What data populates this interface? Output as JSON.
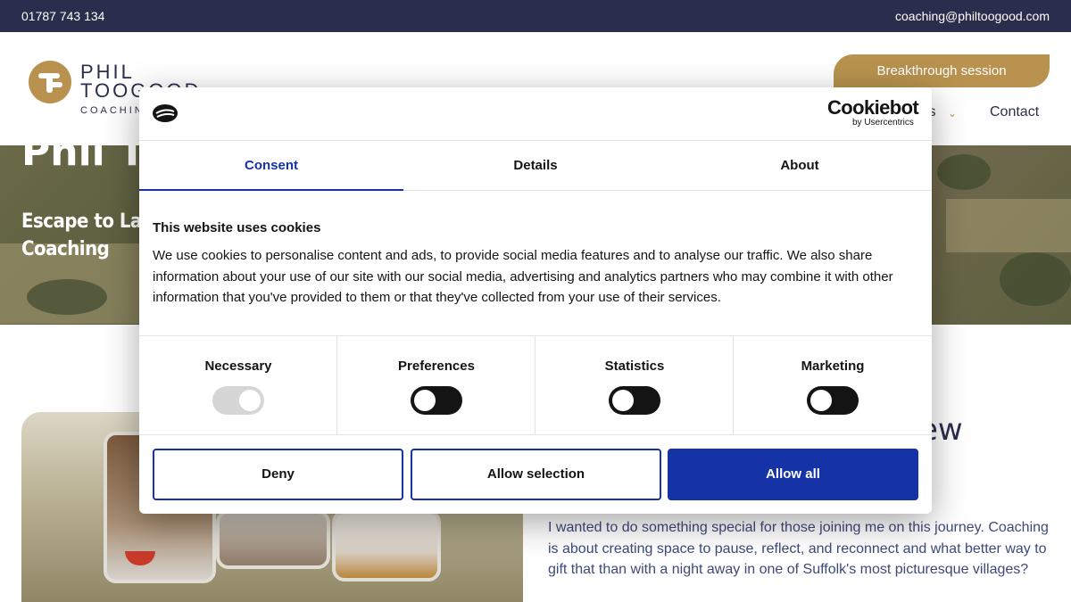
{
  "topbar": {
    "phone": "01787 743 134",
    "email": "coaching@philtoogood.com"
  },
  "header": {
    "logo_name_line1": "PHIL",
    "logo_name_line2": "TOOGOOD",
    "logo_sub": "COACHING",
    "cta": "Breakthrough session",
    "nav_partial": "ts",
    "nav_contact": "Contact",
    "brand_color": "#b8924e"
  },
  "hero": {
    "big_title": "Phil To",
    "subtitle": "Escape to Laven Coaching"
  },
  "section": {
    "heading_partial": "ew",
    "body": "I wanted to do something special for those joining me on this journey. Coaching is about creating space to pause, reflect, and reconnect and what better way to gift that than with a night away in one of Suffolk's most picturesque villages?"
  },
  "cookie": {
    "brand": "Cookiebot",
    "brand_sub": "by Usercentrics",
    "tabs": [
      "Consent",
      "Details",
      "About"
    ],
    "title": "This website uses cookies",
    "text": "We use cookies to personalise content and ads, to provide social media features and to analyse our traffic. We also share information about your use of our site with our social media, advertising and analytics partners who may combine it with other information that you've provided to them or that they've collected from your use of their services.",
    "categories": [
      "Necessary",
      "Preferences",
      "Statistics",
      "Marketing"
    ],
    "buttons": {
      "deny": "Deny",
      "selection": "Allow selection",
      "all": "Allow all"
    },
    "accent_color": "#1532a6"
  }
}
